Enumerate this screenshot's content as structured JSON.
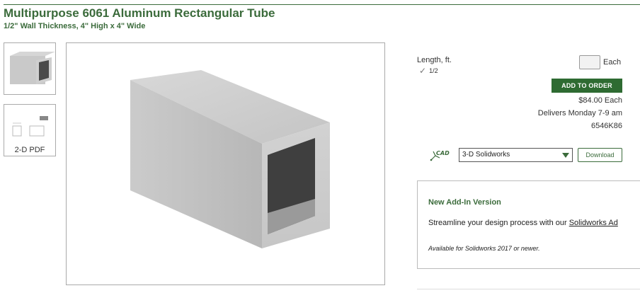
{
  "product": {
    "title": "Multipurpose 6061 Aluminum Rectangular Tube",
    "subtitle": "1/2\" Wall Thickness, 4\" High x 4\" Wide"
  },
  "gallery": {
    "thumb_pdf_label": "2-D PDF"
  },
  "order": {
    "length_label": "Length, ft.",
    "length_value": "1/2",
    "qty_value": "",
    "each_label": "Each",
    "add_button": "ADD TO ORDER",
    "price": "$84.00 Each",
    "delivery": "Delivers Monday 7-9 am",
    "part_number": "6546K86"
  },
  "cad": {
    "icon_label": "CAD",
    "selected_format": "3-D Solidworks",
    "download_label": "Download"
  },
  "addin": {
    "title": "New Add-In Version",
    "text_prefix": "Streamline your design process with our ",
    "link_text": "Solidworks Ad",
    "note": "Available for Solidworks 2017 or newer."
  },
  "colors": {
    "brand_green": "#3b6b3b",
    "button_green": "#2e6b32"
  }
}
